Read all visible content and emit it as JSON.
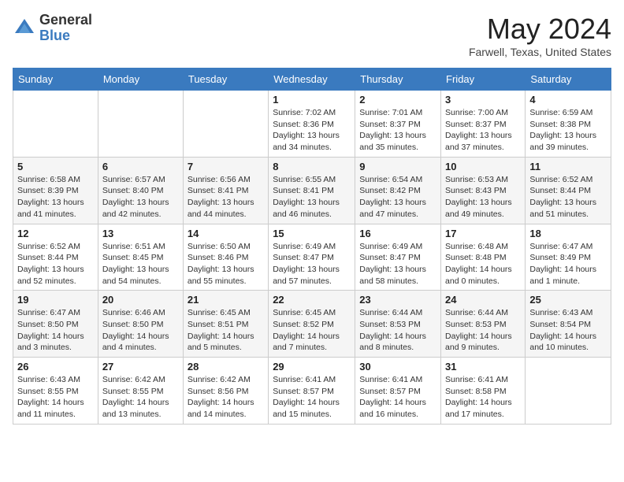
{
  "header": {
    "logo_general": "General",
    "logo_blue": "Blue",
    "month_title": "May 2024",
    "location": "Farwell, Texas, United States"
  },
  "days_of_week": [
    "Sunday",
    "Monday",
    "Tuesday",
    "Wednesday",
    "Thursday",
    "Friday",
    "Saturday"
  ],
  "weeks": [
    [
      {
        "day": "",
        "sunrise": "",
        "sunset": "",
        "daylight": ""
      },
      {
        "day": "",
        "sunrise": "",
        "sunset": "",
        "daylight": ""
      },
      {
        "day": "",
        "sunrise": "",
        "sunset": "",
        "daylight": ""
      },
      {
        "day": "1",
        "sunrise": "Sunrise: 7:02 AM",
        "sunset": "Sunset: 8:36 PM",
        "daylight": "Daylight: 13 hours and 34 minutes."
      },
      {
        "day": "2",
        "sunrise": "Sunrise: 7:01 AM",
        "sunset": "Sunset: 8:37 PM",
        "daylight": "Daylight: 13 hours and 35 minutes."
      },
      {
        "day": "3",
        "sunrise": "Sunrise: 7:00 AM",
        "sunset": "Sunset: 8:37 PM",
        "daylight": "Daylight: 13 hours and 37 minutes."
      },
      {
        "day": "4",
        "sunrise": "Sunrise: 6:59 AM",
        "sunset": "Sunset: 8:38 PM",
        "daylight": "Daylight: 13 hours and 39 minutes."
      }
    ],
    [
      {
        "day": "5",
        "sunrise": "Sunrise: 6:58 AM",
        "sunset": "Sunset: 8:39 PM",
        "daylight": "Daylight: 13 hours and 41 minutes."
      },
      {
        "day": "6",
        "sunrise": "Sunrise: 6:57 AM",
        "sunset": "Sunset: 8:40 PM",
        "daylight": "Daylight: 13 hours and 42 minutes."
      },
      {
        "day": "7",
        "sunrise": "Sunrise: 6:56 AM",
        "sunset": "Sunset: 8:41 PM",
        "daylight": "Daylight: 13 hours and 44 minutes."
      },
      {
        "day": "8",
        "sunrise": "Sunrise: 6:55 AM",
        "sunset": "Sunset: 8:41 PM",
        "daylight": "Daylight: 13 hours and 46 minutes."
      },
      {
        "day": "9",
        "sunrise": "Sunrise: 6:54 AM",
        "sunset": "Sunset: 8:42 PM",
        "daylight": "Daylight: 13 hours and 47 minutes."
      },
      {
        "day": "10",
        "sunrise": "Sunrise: 6:53 AM",
        "sunset": "Sunset: 8:43 PM",
        "daylight": "Daylight: 13 hours and 49 minutes."
      },
      {
        "day": "11",
        "sunrise": "Sunrise: 6:52 AM",
        "sunset": "Sunset: 8:44 PM",
        "daylight": "Daylight: 13 hours and 51 minutes."
      }
    ],
    [
      {
        "day": "12",
        "sunrise": "Sunrise: 6:52 AM",
        "sunset": "Sunset: 8:44 PM",
        "daylight": "Daylight: 13 hours and 52 minutes."
      },
      {
        "day": "13",
        "sunrise": "Sunrise: 6:51 AM",
        "sunset": "Sunset: 8:45 PM",
        "daylight": "Daylight: 13 hours and 54 minutes."
      },
      {
        "day": "14",
        "sunrise": "Sunrise: 6:50 AM",
        "sunset": "Sunset: 8:46 PM",
        "daylight": "Daylight: 13 hours and 55 minutes."
      },
      {
        "day": "15",
        "sunrise": "Sunrise: 6:49 AM",
        "sunset": "Sunset: 8:47 PM",
        "daylight": "Daylight: 13 hours and 57 minutes."
      },
      {
        "day": "16",
        "sunrise": "Sunrise: 6:49 AM",
        "sunset": "Sunset: 8:47 PM",
        "daylight": "Daylight: 13 hours and 58 minutes."
      },
      {
        "day": "17",
        "sunrise": "Sunrise: 6:48 AM",
        "sunset": "Sunset: 8:48 PM",
        "daylight": "Daylight: 14 hours and 0 minutes."
      },
      {
        "day": "18",
        "sunrise": "Sunrise: 6:47 AM",
        "sunset": "Sunset: 8:49 PM",
        "daylight": "Daylight: 14 hours and 1 minute."
      }
    ],
    [
      {
        "day": "19",
        "sunrise": "Sunrise: 6:47 AM",
        "sunset": "Sunset: 8:50 PM",
        "daylight": "Daylight: 14 hours and 3 minutes."
      },
      {
        "day": "20",
        "sunrise": "Sunrise: 6:46 AM",
        "sunset": "Sunset: 8:50 PM",
        "daylight": "Daylight: 14 hours and 4 minutes."
      },
      {
        "day": "21",
        "sunrise": "Sunrise: 6:45 AM",
        "sunset": "Sunset: 8:51 PM",
        "daylight": "Daylight: 14 hours and 5 minutes."
      },
      {
        "day": "22",
        "sunrise": "Sunrise: 6:45 AM",
        "sunset": "Sunset: 8:52 PM",
        "daylight": "Daylight: 14 hours and 7 minutes."
      },
      {
        "day": "23",
        "sunrise": "Sunrise: 6:44 AM",
        "sunset": "Sunset: 8:53 PM",
        "daylight": "Daylight: 14 hours and 8 minutes."
      },
      {
        "day": "24",
        "sunrise": "Sunrise: 6:44 AM",
        "sunset": "Sunset: 8:53 PM",
        "daylight": "Daylight: 14 hours and 9 minutes."
      },
      {
        "day": "25",
        "sunrise": "Sunrise: 6:43 AM",
        "sunset": "Sunset: 8:54 PM",
        "daylight": "Daylight: 14 hours and 10 minutes."
      }
    ],
    [
      {
        "day": "26",
        "sunrise": "Sunrise: 6:43 AM",
        "sunset": "Sunset: 8:55 PM",
        "daylight": "Daylight: 14 hours and 11 minutes."
      },
      {
        "day": "27",
        "sunrise": "Sunrise: 6:42 AM",
        "sunset": "Sunset: 8:55 PM",
        "daylight": "Daylight: 14 hours and 13 minutes."
      },
      {
        "day": "28",
        "sunrise": "Sunrise: 6:42 AM",
        "sunset": "Sunset: 8:56 PM",
        "daylight": "Daylight: 14 hours and 14 minutes."
      },
      {
        "day": "29",
        "sunrise": "Sunrise: 6:41 AM",
        "sunset": "Sunset: 8:57 PM",
        "daylight": "Daylight: 14 hours and 15 minutes."
      },
      {
        "day": "30",
        "sunrise": "Sunrise: 6:41 AM",
        "sunset": "Sunset: 8:57 PM",
        "daylight": "Daylight: 14 hours and 16 minutes."
      },
      {
        "day": "31",
        "sunrise": "Sunrise: 6:41 AM",
        "sunset": "Sunset: 8:58 PM",
        "daylight": "Daylight: 14 hours and 17 minutes."
      },
      {
        "day": "",
        "sunrise": "",
        "sunset": "",
        "daylight": ""
      }
    ]
  ]
}
